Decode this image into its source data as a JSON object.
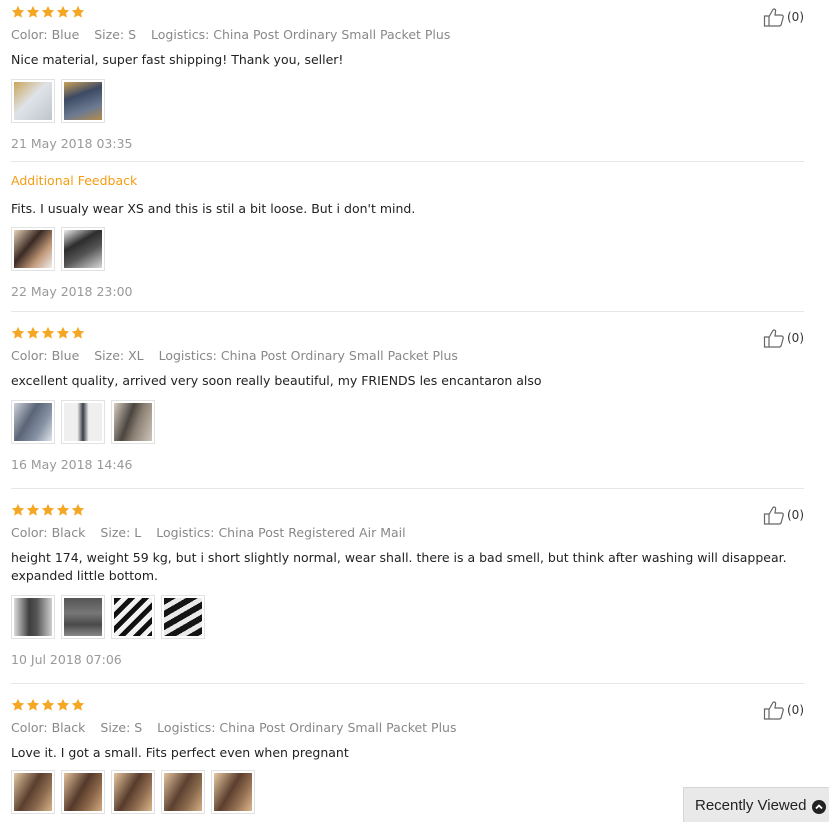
{
  "colors": {
    "star": "#f5a623",
    "meta": "#888888",
    "accent": "#f39c12"
  },
  "reviews": [
    {
      "stars": 5,
      "likes": "(0)",
      "color": "Color: Blue",
      "size": "Size: S",
      "logistics": "Logistics: China Post Ordinary Small Packet Plus",
      "text": "Nice material, super fast shipping! Thank you, seller!",
      "date": "21 May 2018 03:35",
      "additional_label": "Additional Feedback",
      "additional_text": "Fits. I usualy wear XS and this is stil a bit loose. But i don't mind.",
      "additional_date": "22 May 2018 23:00"
    },
    {
      "stars": 5,
      "likes": "(0)",
      "color": "Color: Blue",
      "size": "Size: XL",
      "logistics": "Logistics: China Post Ordinary Small Packet Plus",
      "text": "excellent quality, arrived very soon really beautiful, my FRIENDS les encantaron also",
      "date": "16 May 2018 14:46"
    },
    {
      "stars": 5,
      "likes": "(0)",
      "color": "Color: Black",
      "size": "Size: L",
      "logistics": "Logistics: China Post Registered Air Mail",
      "text": "height 174, weight 59 kg, but i short slightly normal, wear shall. there is a bad smell, but think after washing will disappear. expanded little bottom.",
      "date": "10 Jul 2018 07:06"
    },
    {
      "stars": 5,
      "likes": "(0)",
      "color": "Color: Black",
      "size": "Size: S",
      "logistics": "Logistics: China Post Ordinary Small Packet Plus",
      "text": "Love it. I got a small. Fits perfect even when pregnant"
    }
  ],
  "recently_viewed": {
    "label": "Recently Viewed",
    "icon": "chevron-up-icon"
  }
}
